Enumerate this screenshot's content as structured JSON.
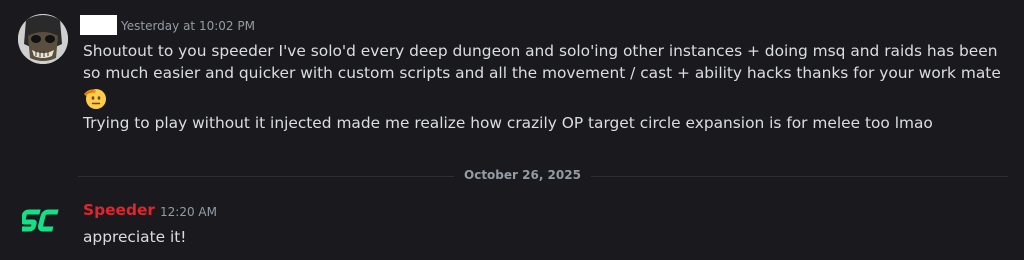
{
  "messages": [
    {
      "timestamp": "Yesterday at 10:02 PM",
      "avatar_icon": "skull-mask-avatar-icon",
      "lines": [
        "Shoutout to you speeder I've solo'd every deep dungeon and solo'ing other instances + doing msq and raids has been",
        "so much easier and quicker with custom scripts and all the movement / cast + ability hacks thanks for your work mate",
        "Trying to play without it injected made me realize how crazily OP target circle expansion is for melee too lmao"
      ],
      "emoji": "saluting-face-icon"
    },
    {
      "username": "Speeder",
      "timestamp": "12:20 AM",
      "avatar_icon": "sc-logo-icon",
      "text": "appreciate it!"
    }
  ],
  "date_divider": "October 26, 2025",
  "colors": {
    "background": "#1a1a1e",
    "text": "#dbdee1",
    "muted": "#949ba4",
    "username_red": "#e0252d",
    "logo_green": "#16e087"
  }
}
